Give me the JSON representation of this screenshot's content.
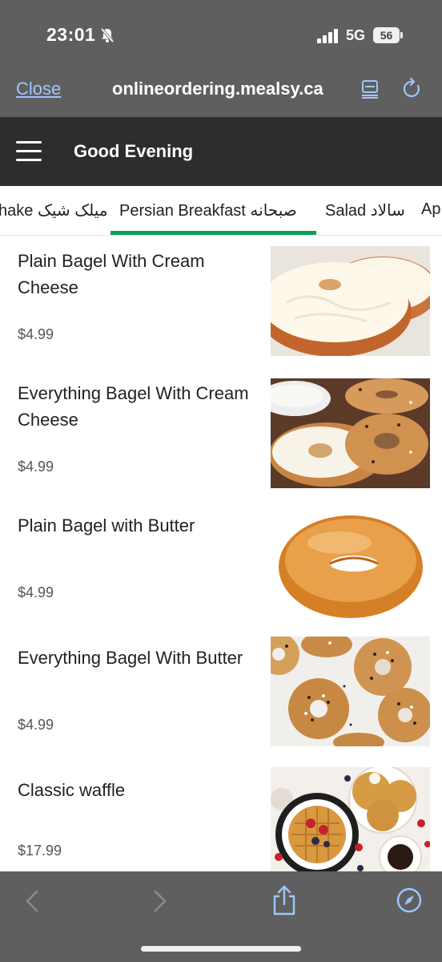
{
  "status_bar": {
    "time": "23:01",
    "network": "5G",
    "battery": "56"
  },
  "browser": {
    "close_label": "Close",
    "url": "onlineordering.mealsy.ca"
  },
  "app": {
    "greeting": "Good Evening"
  },
  "tabs": [
    {
      "label": "hake میلک شیک"
    },
    {
      "label": "Persian Breakfast صبحانه",
      "active": true
    },
    {
      "label": "Salad سالاد"
    },
    {
      "label": "Ap"
    }
  ],
  "menu": {
    "items": [
      {
        "name": "Plain Bagel With Cream Cheese",
        "price": "$4.99",
        "image": "bagel-cream-cheese"
      },
      {
        "name": "Everything Bagel With Cream Cheese",
        "price": "$4.99",
        "image": "everything-bagel-cream-cheese"
      },
      {
        "name": "Plain Bagel with Butter",
        "price": "$4.99",
        "image": "plain-bagel"
      },
      {
        "name": "Everything Bagel With Butter",
        "price": "$4.99",
        "image": "everything-bagels"
      },
      {
        "name": "Classic waffle",
        "price": "$17.99",
        "image": "waffles"
      }
    ]
  },
  "colors": {
    "chrome": "#5f5f5f",
    "appbar": "#2d2d2d",
    "accent_green": "#0aa055",
    "ios_blue": "#9fc6ff"
  }
}
